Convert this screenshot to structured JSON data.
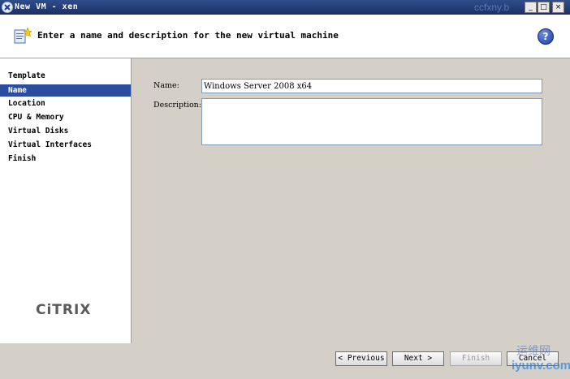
{
  "window": {
    "title": "New VM - xen",
    "watermark": "ccfxny.b",
    "controls": {
      "minimize": "_",
      "maximize": "□",
      "close": "×"
    }
  },
  "header": {
    "instruction": "Enter a name and description for the new virtual machine",
    "help_label": "?"
  },
  "sidebar": {
    "steps": [
      {
        "label": "Template"
      },
      {
        "label": "Name",
        "active": true
      },
      {
        "label": "Location"
      },
      {
        "label": "CPU & Memory"
      },
      {
        "label": "Virtual Disks"
      },
      {
        "label": "Virtual Interfaces"
      },
      {
        "label": "Finish"
      }
    ],
    "logo": "CiTRIX"
  },
  "form": {
    "name_label": "Name:",
    "name_value": "Windows Server 2008 x64",
    "description_label": "Description:",
    "description_value": ""
  },
  "footer": {
    "previous_label": "< Previous",
    "next_label": "Next >",
    "finish_label": "Finish",
    "cancel_label": "Cancel"
  },
  "corner_watermark": {
    "line1": "运维网",
    "line2": "iyunv.com"
  },
  "colors": {
    "titlebar": "#1b2f66",
    "active_step": "#2a4da0",
    "panel": "#d4d0c8"
  },
  "icons": [
    "app-icon",
    "new-vm-icon",
    "help-icon"
  ]
}
